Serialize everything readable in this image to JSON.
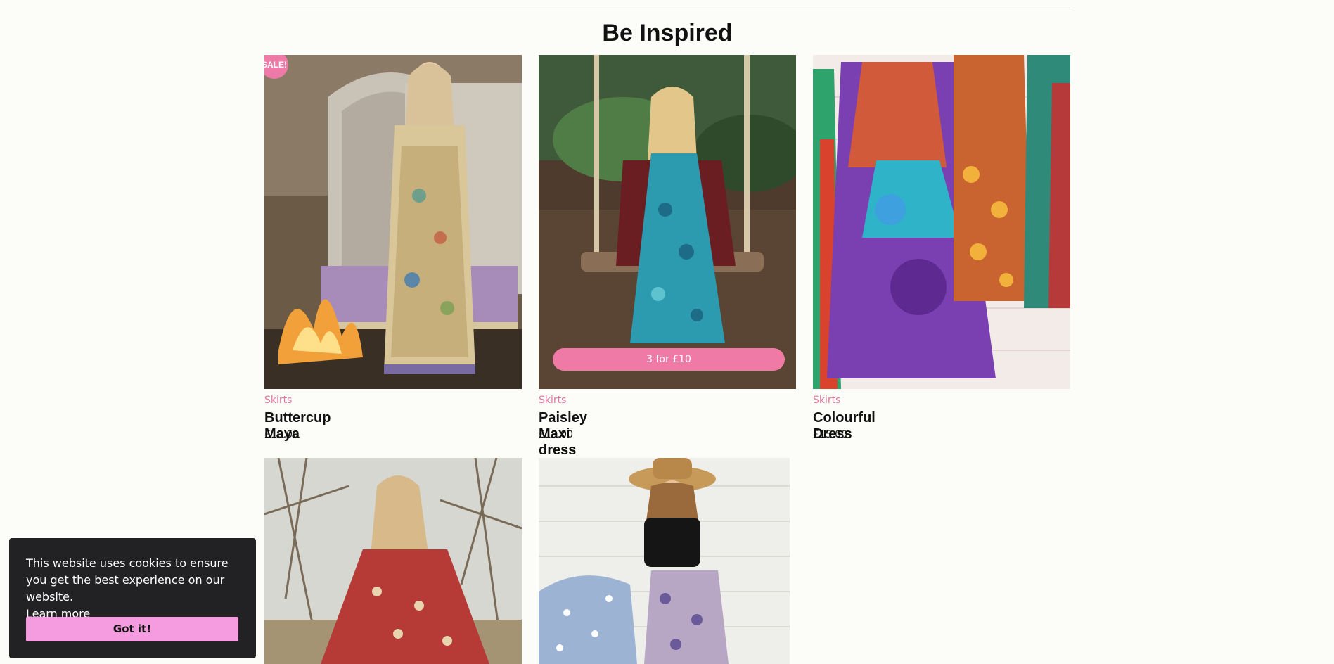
{
  "section": {
    "title": "Be Inspired"
  },
  "products": [
    {
      "category": "Skirts",
      "name": "Buttercup Maya",
      "price": "£10.00",
      "badge": "SALE!",
      "image_icon": "woman-in-floral-maxi-dress-by-fire"
    },
    {
      "category": "Skirts",
      "name": "Paisley Maxi dress",
      "price": "£15.00",
      "promo": "3 for £10",
      "image_icon": "woman-on-swing-in-blue-paisley-dress"
    },
    {
      "category": "Skirts",
      "name": "Colourful Dress",
      "price": "£15.00",
      "image_icon": "tie-dye-dress-on-rack"
    },
    {
      "image_icon": "woman-in-red-printed-dress-sitting"
    },
    {
      "image_icon": "woman-in-cowboy-hat-and-floral-skirt"
    }
  ],
  "cookie_banner": {
    "message": "This website uses cookies to ensure you get the best experience on our website.",
    "learn_more": "Learn more",
    "accept": "Got it!"
  },
  "colors": {
    "accent_pink": "#ef7aa6",
    "button_pink": "#f59be0",
    "banner_bg": "#222224",
    "page_bg": "#fcfcf8"
  }
}
